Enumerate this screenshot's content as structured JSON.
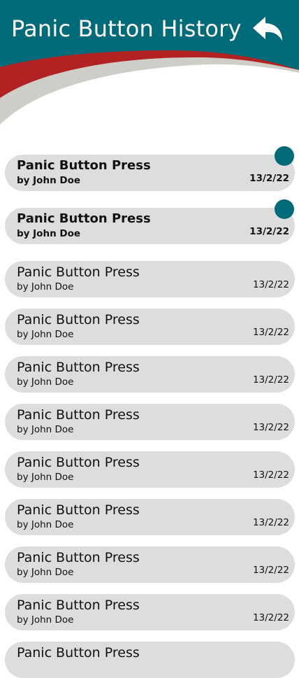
{
  "header": {
    "title": "Panic Button History",
    "back_icon": "reply-arrow-icon",
    "colors": {
      "primary": "#006a78",
      "accent": "#b22222",
      "wave_gray": "#cfcdc8"
    }
  },
  "items": [
    {
      "title": "Panic Button Press",
      "subtitle": "by John Doe",
      "date": "13/2/22",
      "unread": true
    },
    {
      "title": "Panic Button Press",
      "subtitle": "by John Doe",
      "date": "13/2/22",
      "unread": true
    },
    {
      "title": "Panic Button Press",
      "subtitle": "by John Doe",
      "date": "13/2/22",
      "unread": false
    },
    {
      "title": "Panic Button Press",
      "subtitle": "by John Doe",
      "date": "13/2/22",
      "unread": false
    },
    {
      "title": "Panic Button Press",
      "subtitle": "by John Doe",
      "date": "13/2/22",
      "unread": false
    },
    {
      "title": "Panic Button Press",
      "subtitle": "by John Doe",
      "date": "13/2/22",
      "unread": false
    },
    {
      "title": "Panic Button Press",
      "subtitle": "by John Doe",
      "date": "13/2/22",
      "unread": false
    },
    {
      "title": "Panic Button Press",
      "subtitle": "by John Doe",
      "date": "13/2/22",
      "unread": false
    },
    {
      "title": "Panic Button Press",
      "subtitle": "by John Doe",
      "date": "13/2/22",
      "unread": false
    },
    {
      "title": "Panic Button Press",
      "subtitle": "by John Doe",
      "date": "13/2/22",
      "unread": false
    },
    {
      "title": "Panic Button Press",
      "subtitle": "",
      "date": "",
      "unread": false
    }
  ]
}
